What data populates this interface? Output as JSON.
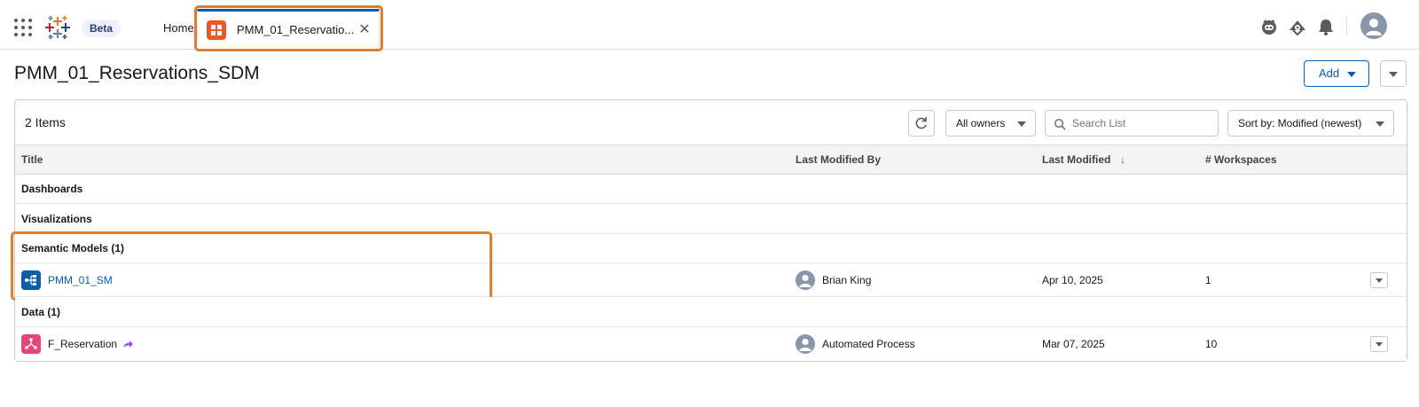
{
  "topbar": {
    "beta_label": "Beta",
    "home_tab": "Home",
    "active_tab": {
      "label": "PMM_01_Reservatio...",
      "close_glyph": "✕"
    },
    "icons": [
      "app-launcher-icon",
      "tableau-logo-icon",
      "agent-icon",
      "setup-icon",
      "notifications-bell-icon",
      "user-avatar-icon"
    ]
  },
  "page": {
    "title": "PMM_01_Reservations_SDM",
    "add_button": "Add"
  },
  "list": {
    "count_label": "2 Items",
    "owners_filter": "All owners",
    "search_placeholder": "Search List",
    "sort_label": "Sort by: Modified (newest)",
    "columns": {
      "title": "Title",
      "modified_by": "Last Modified By",
      "modified": "Last Modified",
      "sort_arrow": "↓",
      "workspaces": "# Workspaces"
    },
    "groups": {
      "dashboards": "Dashboards",
      "visualizations": "Visualizations",
      "semantic_models": "Semantic Models (1)",
      "data": "Data (1)"
    },
    "rows": [
      {
        "title": "PMM_01_SM",
        "modified_by": "Brian King",
        "modified": "Apr 10, 2025",
        "workspaces": "1",
        "icon": "semantic-model-icon",
        "icon_color": "#0b5cab"
      },
      {
        "title": "F_Reservation",
        "modified_by": "Automated Process",
        "modified": "Mar 07, 2025",
        "workspaces": "10",
        "icon": "data-object-icon",
        "icon_color": "#e3467c"
      }
    ]
  },
  "colors": {
    "brand_blue": "#0b5cab",
    "highlight": "#d9812e",
    "tab_icon": "#ea5a24",
    "beta_bg": "#eef0fb"
  }
}
